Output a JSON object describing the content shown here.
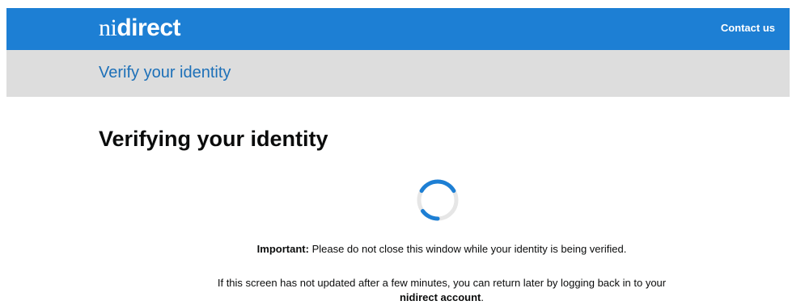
{
  "header": {
    "logo_prefix": "ni",
    "logo_bold": "direct",
    "contact_label": "Contact us",
    "background": "#1d7fd4"
  },
  "subheader": {
    "title": "Verify your identity",
    "background": "#dddddd"
  },
  "main": {
    "heading": "Verifying your identity",
    "spinner_icon": "loading-spinner-icon",
    "important_label": "Important:",
    "important_text": " Please do not close this window while your identity is being verified.",
    "info_text": "If this screen has not updated after a few minutes, you can return later by logging back in to your ",
    "info_bold": "nidirect account",
    "info_end": "."
  }
}
